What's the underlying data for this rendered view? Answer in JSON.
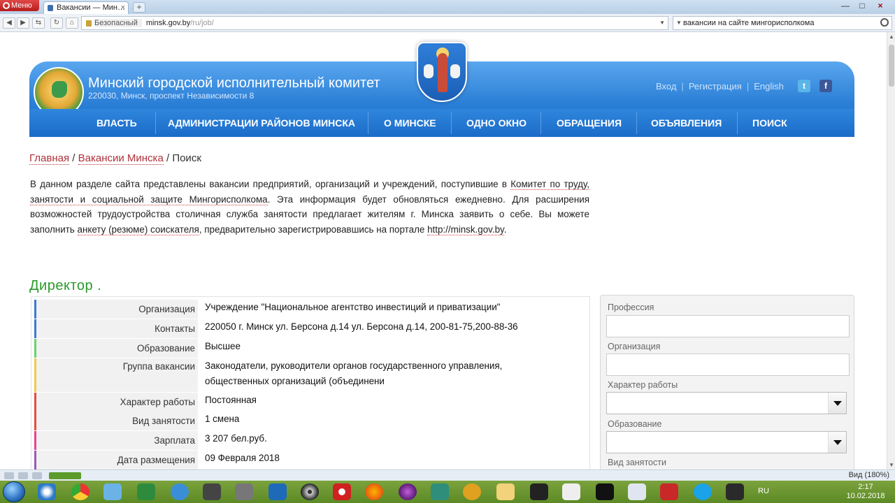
{
  "browser": {
    "menu_label": "Меню",
    "tab_title": "Вакансии — Мин…",
    "tab_close": "×",
    "new_tab": "+",
    "win_min": "—",
    "win_max": "□",
    "win_close": "×",
    "security_label": "Безопасный",
    "url_host": "minsk.gov.by",
    "url_path": "/ru/job/",
    "search_query": "вакансии на сайте мингорисполкома",
    "zoom_label": "Вид (180%)"
  },
  "site": {
    "title": "Минский городской исполнительный комитет",
    "address": "220030, Минск, проспект Независимости 8",
    "top_links": {
      "login": "Вход",
      "sep": "|",
      "register": "Регистрация",
      "english": "English"
    },
    "social": {
      "twitter": "t",
      "facebook": "f"
    },
    "nav": [
      "ВЛАСТЬ",
      "АДМИНИСТРАЦИИ РАЙОНОВ МИНСКА",
      "О МИНСКЕ",
      "ОДНО ОКНО",
      "ОБРАЩЕНИЯ",
      "ОБЪЯВЛЕНИЯ",
      "ПОИСК"
    ]
  },
  "breadcrumb": {
    "home": "Главная",
    "sep": " / ",
    "section": "Вакансии Минска",
    "current": "Поиск"
  },
  "intro": {
    "t1": "В данном разделе сайта представлены вакансии предприятий, организаций и учреждений, поступившие в ",
    "link1": "Комитет по труду, занятости и социальной защите Мингорисполкома",
    "t2": ". Эта информация будет обновляться ежедневно. Для расширения возможностей трудоустройства столичная служба занятости предлагает жителям г. Минска заявить о себе. Вы можете заполнить ",
    "link2": "анкету (резюме) соискателя",
    "t3": ", предварительно зарегистрировавшись на портале ",
    "link3": "http://minsk.gov.by",
    "t4": "."
  },
  "vacancy": {
    "title": "Директор .",
    "rows": [
      {
        "label": "Организация",
        "value": "Учреждение \"Национальное агентство инвестиций и приватизации\"",
        "color": "#3a7bd5"
      },
      {
        "label": "Контакты",
        "value": "220050 г. Минск ул. Берсона д.14 ул. Берсона д.14, 200-81-75,200-88-36",
        "color": "#3a7bd5"
      },
      {
        "label": "Образование",
        "value": "Высшее",
        "color": "#6ad36a"
      },
      {
        "label": "Группа вакансии",
        "value": "Законодатели, руководители органов государственного управления, общественных организаций (объединени",
        "color": "#f2c94c"
      },
      {
        "label": "Характер работы",
        "value": "Постоянная",
        "color": "#e74c3c"
      },
      {
        "label": "Вид занятости",
        "value": "1 смена",
        "color": "#e74c3c"
      },
      {
        "label": "Зарплата",
        "value": "3 207 бел.руб.",
        "color": "#e84393"
      },
      {
        "label": "Дата размещения",
        "value": "09 Февраля 2018",
        "color": "#9b59b6"
      }
    ]
  },
  "search_panel": {
    "profession_label": "Профессия",
    "organization_label": "Организация",
    "work_type_label": "Характер работы",
    "education_label": "Образование",
    "employment_label": "Вид занятости"
  },
  "taskbar": {
    "lang": "RU",
    "time": "2:17",
    "date": "10.02.2018"
  }
}
